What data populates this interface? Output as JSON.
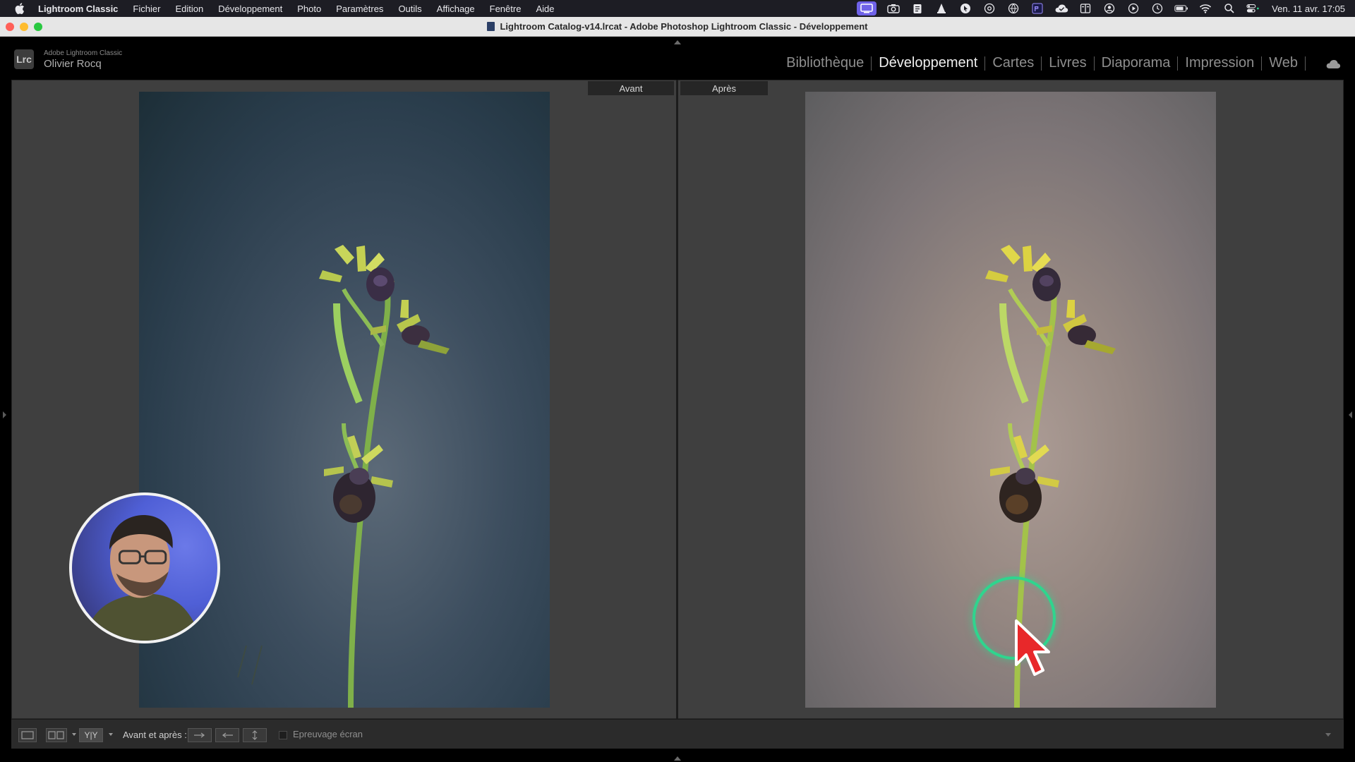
{
  "menubar": {
    "app_name": "Lightroom Classic",
    "items": [
      "Fichier",
      "Edition",
      "Développement",
      "Photo",
      "Paramètres",
      "Outils",
      "Affichage",
      "Fenêtre",
      "Aide"
    ],
    "clock": "Ven. 11 avr.  17:05",
    "status_icons": [
      "screen-record-icon",
      "camera-icon",
      "clipboard-icon",
      "vlc-icon",
      "cursor-app-icon",
      "mail-icon",
      "network-icon",
      "premiere-icon",
      "cloud-check-icon",
      "display-icon",
      "user-icon",
      "play-icon",
      "clock-icon",
      "battery-icon",
      "wifi-icon",
      "search-icon",
      "control-center-icon"
    ],
    "colors": {
      "active_icon_bg": "#6f62e8"
    }
  },
  "window": {
    "title": "Lightroom Catalog-v14.lrcat - Adobe Photoshop Lightroom Classic - Développement",
    "traffic_lights": [
      "#ff5f57",
      "#febc2e",
      "#28c840"
    ]
  },
  "identity": {
    "badge": "Lrc",
    "product": "Adobe Lightroom Classic",
    "user": "Olivier Rocq"
  },
  "modules": {
    "items": [
      "Bibliothèque",
      "Développement",
      "Cartes",
      "Livres",
      "Diaporama",
      "Impression",
      "Web"
    ],
    "active": "Développement"
  },
  "compare": {
    "before_label": "Avant",
    "after_label": "Après"
  },
  "toolbar": {
    "view_yy_label": "Y|Y",
    "before_after_label": "Avant et après :",
    "proofing_label": "Epreuvage écran",
    "proofing_checked": false
  },
  "colors": {
    "cursor_ring": "#2fd58e",
    "cursor_arrow": "#e8282a"
  }
}
